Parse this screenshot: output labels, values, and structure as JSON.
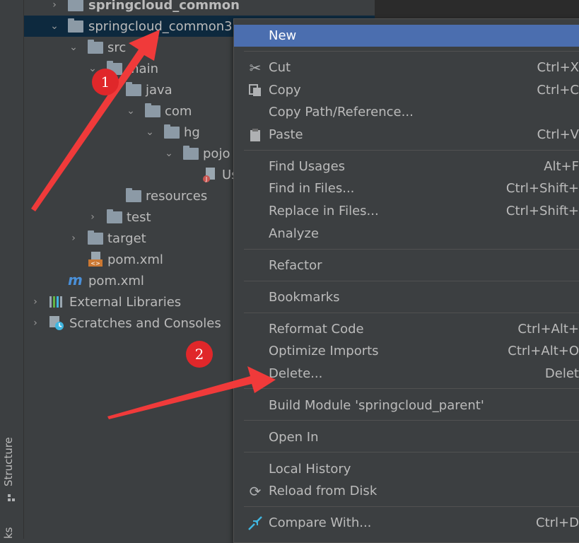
{
  "left_strip": {
    "structure_label": "Structure",
    "bookmarks_label_partial": "ks"
  },
  "tree": {
    "items": [
      {
        "label": "springcloud_common",
        "bold": true
      },
      {
        "label": "springcloud_common3"
      },
      {
        "label": "src"
      },
      {
        "label": "main"
      },
      {
        "label": "java"
      },
      {
        "label": "com"
      },
      {
        "label": "hg"
      },
      {
        "label": "pojo"
      },
      {
        "label": "Us"
      },
      {
        "label": "resources"
      },
      {
        "label": "test"
      },
      {
        "label": "target"
      },
      {
        "label": "pom.xml"
      },
      {
        "label": "pom.xml"
      },
      {
        "label": "External Libraries"
      },
      {
        "label": "Scratches and Consoles"
      }
    ]
  },
  "context_menu": {
    "items": [
      {
        "label": "New",
        "shortcut": ""
      },
      {
        "label": "Cut",
        "shortcut": "Ctrl+X",
        "icon": "scissors-icon"
      },
      {
        "label": "Copy",
        "shortcut": "Ctrl+C",
        "icon": "copy-icon"
      },
      {
        "label": "Copy Path/Reference...",
        "shortcut": ""
      },
      {
        "label": "Paste",
        "shortcut": "Ctrl+V",
        "icon": "paste-icon"
      },
      {
        "label": "Find Usages",
        "shortcut": "Alt+F"
      },
      {
        "label": "Find in Files...",
        "shortcut": "Ctrl+Shift+"
      },
      {
        "label": "Replace in Files...",
        "shortcut": "Ctrl+Shift+"
      },
      {
        "label": "Analyze",
        "shortcut": ""
      },
      {
        "label": "Refactor",
        "shortcut": ""
      },
      {
        "label": "Bookmarks",
        "shortcut": ""
      },
      {
        "label": "Reformat Code",
        "shortcut": "Ctrl+Alt+"
      },
      {
        "label": "Optimize Imports",
        "shortcut": "Ctrl+Alt+O"
      },
      {
        "label": "Delete...",
        "shortcut": "Delet"
      },
      {
        "label": "Build Module 'springcloud_parent'",
        "shortcut": ""
      },
      {
        "label": "Open In",
        "shortcut": ""
      },
      {
        "label": "Local History",
        "shortcut": ""
      },
      {
        "label": "Reload from Disk",
        "shortcut": "",
        "icon": "reload-icon"
      },
      {
        "label": "Compare With...",
        "shortcut": "Ctrl+D",
        "icon": "compare-icon"
      }
    ]
  },
  "annotations": {
    "badge1": "1",
    "badge2": "2",
    "arrow_color": "#f03a3a"
  },
  "colors": {
    "highlight": "#4b6eaf",
    "selection": "#0d293e",
    "background": "#3c3f41"
  }
}
